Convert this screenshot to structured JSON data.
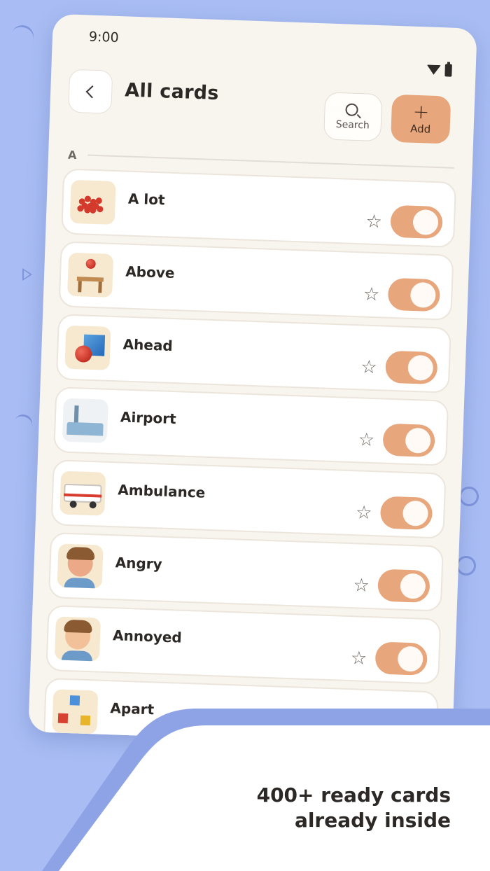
{
  "status_bar": {
    "time": "9:00"
  },
  "header": {
    "title": "All cards",
    "search_label": "Search",
    "add_label": "Add"
  },
  "section": {
    "letter": "A"
  },
  "cards": [
    {
      "label": "A lot",
      "enabled": true,
      "favorite": false
    },
    {
      "label": "Above",
      "enabled": true,
      "favorite": false
    },
    {
      "label": "Ahead",
      "enabled": true,
      "favorite": false
    },
    {
      "label": "Airport",
      "enabled": true,
      "favorite": false
    },
    {
      "label": "Ambulance",
      "enabled": true,
      "favorite": false
    },
    {
      "label": "Angry",
      "enabled": true,
      "favorite": false
    },
    {
      "label": "Annoyed",
      "enabled": true,
      "favorite": false
    },
    {
      "label": "Apart",
      "enabled": true,
      "favorite": false
    }
  ],
  "promo": {
    "line1": "400+ ready cards",
    "line2": "already inside"
  },
  "colors": {
    "background": "#a9bdf4",
    "accent": "#e7a67b",
    "screen": "#f8f4ee",
    "text": "#2c2825"
  },
  "icons": [
    "back-icon",
    "search-icon",
    "plus-icon",
    "star-icon",
    "wifi-icon",
    "battery-icon"
  ]
}
